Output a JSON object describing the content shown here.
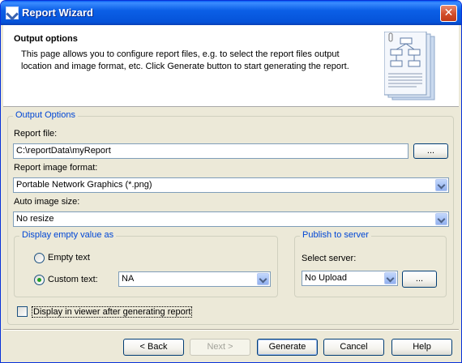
{
  "window": {
    "title": "Report Wizard",
    "close_glyph": "✕"
  },
  "header": {
    "title": "Output options",
    "description": "This page allows you to configure report files, e.g. to select the report files output location and image format, etc. Click Generate button to start generating the report."
  },
  "output_options": {
    "legend": "Output Options",
    "report_file_label": "Report file:",
    "report_file_value": "C:\\reportData\\myReport",
    "browse_label": "...",
    "image_format_label": "Report image format:",
    "image_format_value": "Portable Network Graphics (*.png)",
    "auto_size_label": "Auto image size:",
    "auto_size_value": "No resize"
  },
  "empty_value": {
    "legend": "Display empty value as",
    "empty_text_label": "Empty text",
    "custom_text_label": "Custom text:",
    "custom_text_value": "NA",
    "selected": "custom_text"
  },
  "publish": {
    "legend": "Publish to server",
    "select_server_label": "Select server:",
    "server_value": "No Upload",
    "browse_label": "..."
  },
  "display_in_viewer": {
    "label": "Display in viewer after generating report",
    "checked": false
  },
  "buttons": {
    "back_label": "< Back",
    "next_label": "Next >",
    "generate_label": "Generate",
    "cancel_label": "Cancel",
    "help_label": "Help"
  },
  "colors": {
    "title_bar": "#0553d9",
    "group_legend": "#0046d5",
    "dialog_bg": "#ece9d8"
  }
}
